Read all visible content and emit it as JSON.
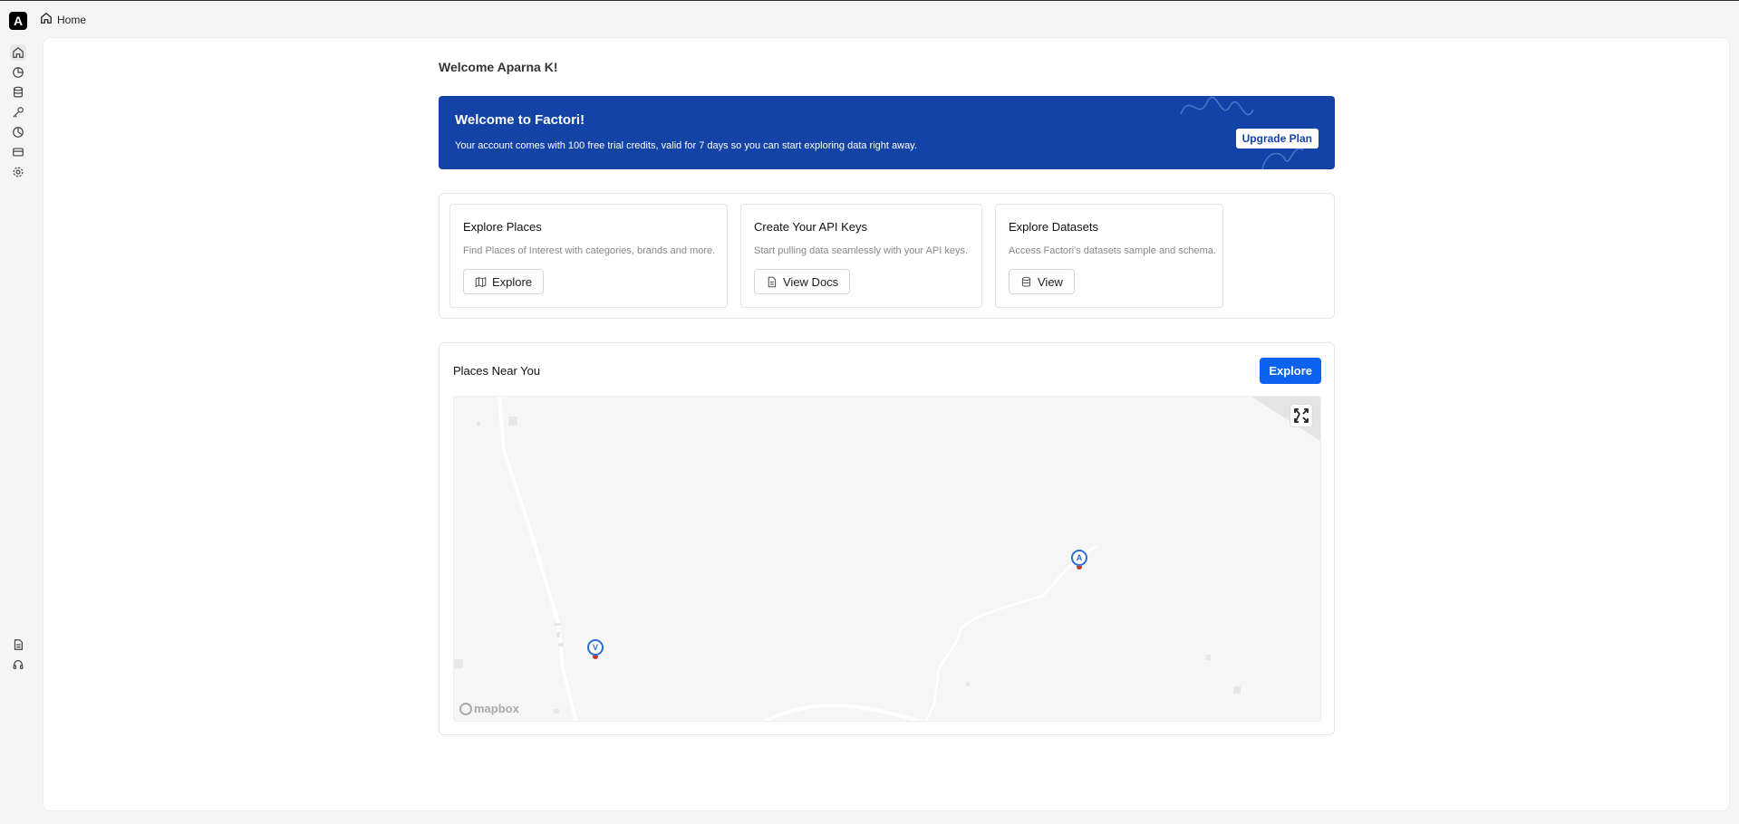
{
  "app": {
    "logo_letter": "A"
  },
  "breadcrumb": {
    "label": "Home"
  },
  "sidebar": {
    "top_items": [
      {
        "icon": "home-icon",
        "active": true
      },
      {
        "icon": "analytics-icon"
      },
      {
        "icon": "database-icon"
      },
      {
        "icon": "key-icon"
      },
      {
        "icon": "pie-chart-icon"
      },
      {
        "icon": "credit-card-icon"
      },
      {
        "icon": "settings-icon"
      }
    ],
    "bottom_items": [
      {
        "icon": "document-icon"
      },
      {
        "icon": "headset-icon"
      }
    ]
  },
  "main": {
    "welcome_text": "Welcome Aparna K!",
    "banner": {
      "title": "Welcome to Factori!",
      "text": "Your account comes with 100 free trial credits, valid for 7 days so you can start exploring data right away.",
      "button_label": "Upgrade Plan",
      "background_color": "#1443a8"
    },
    "cards": [
      {
        "title": "Explore Places",
        "description": "Find Places of Interest with categories, brands and more.",
        "button_label": "Explore",
        "button_icon": "map-icon"
      },
      {
        "title": "Create Your API Keys",
        "description": "Start pulling data seamlessly with your API keys.",
        "button_label": "View Docs",
        "button_icon": "file-icon"
      },
      {
        "title": "Explore Datasets",
        "description": "Access Factori's datasets sample and schema.",
        "button_label": "View",
        "button_icon": "database-icon"
      }
    ],
    "places": {
      "title": "Places Near You",
      "button_label": "Explore",
      "button_color": "#0b63f0",
      "map": {
        "attribution": "mapbox",
        "markers": [
          {
            "label": "V"
          },
          {
            "label": "A"
          }
        ]
      }
    }
  }
}
